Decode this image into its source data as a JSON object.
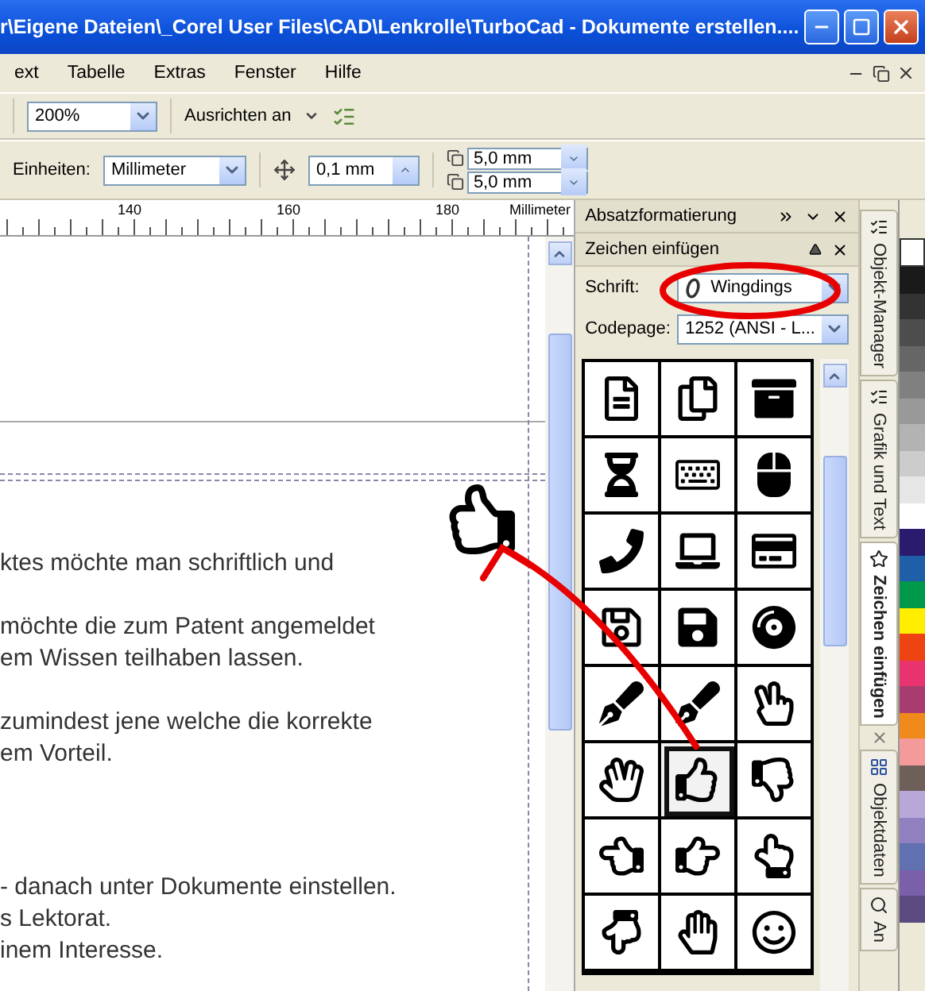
{
  "window": {
    "title": "r\\Eigene Dateien\\_Corel User Files\\CAD\\Lenkrolle\\TurboCad - Dokumente erstellen...."
  },
  "menu": [
    "ext",
    "Tabelle",
    "Extras",
    "Fenster",
    "Hilfe"
  ],
  "toolbar": {
    "zoom": "200%",
    "snap": "Ausrichten an"
  },
  "property_bar": {
    "units_label": "Einheiten:",
    "units": "Millimeter",
    "nudge": "0,1 mm",
    "duplicate_x": "5,0 mm",
    "duplicate_y": "5,0 mm"
  },
  "ruler": {
    "labels": [
      "140",
      "160",
      "180"
    ],
    "unit": "Millimeter"
  },
  "document": {
    "paragraphs": [
      [
        "ktes möchte man schriftlich und"
      ],
      [
        "möchte die zum Patent angemeldet",
        "em Wissen teilhaben lassen."
      ],
      [
        "zumindest jene welche die korrekte",
        "em Vorteil."
      ],
      [
        "- danach unter Dokumente einstellen.",
        "s Lektorat.",
        "inem Interesse."
      ]
    ]
  },
  "docker": {
    "headers": [
      "Absatzformatierung",
      "Zeichen einfügen"
    ],
    "font_label": "Schrift:",
    "font": "Wingdings",
    "codepage_label": "Codepage:",
    "codepage": "1252  (ANSI - L...",
    "cells": [
      {
        "selected": false
      },
      {
        "selected": false
      },
      {
        "selected": false
      },
      {
        "selected": false
      },
      {
        "selected": false
      },
      {
        "selected": false
      },
      {
        "selected": false
      },
      {
        "selected": false
      },
      {
        "selected": false
      },
      {
        "selected": false
      },
      {
        "selected": false
      },
      {
        "selected": false
      },
      {
        "selected": false
      },
      {
        "selected": false
      },
      {
        "selected": false
      },
      {
        "selected": false
      },
      {
        "selected": true
      },
      {
        "selected": false
      },
      {
        "selected": false
      },
      {
        "selected": false
      },
      {
        "selected": false
      },
      {
        "selected": false
      },
      {
        "selected": false
      },
      {
        "selected": false
      }
    ]
  },
  "side_tabs": [
    {
      "label": "Objekt-Manager",
      "selected": false
    },
    {
      "label": "Grafik und Text",
      "selected": false
    },
    {
      "label": "Zeichen einfügen",
      "selected": true
    },
    {
      "label": "Objektdaten",
      "selected": false
    },
    {
      "label": "An",
      "selected": false
    }
  ],
  "palette": [
    {
      "color": "#1a1a1a"
    },
    {
      "color": "#333333"
    },
    {
      "color": "#4d4d4d"
    },
    {
      "color": "#666666"
    },
    {
      "color": "#808080"
    },
    {
      "color": "#999999"
    },
    {
      "color": "#b3b3b3"
    },
    {
      "color": "#cccccc"
    },
    {
      "color": "#e6e6e6"
    },
    {
      "color": "#ffffff"
    },
    {
      "color": "#2b1b6e"
    },
    {
      "color": "#1f5fa8"
    },
    {
      "color": "#00994c"
    },
    {
      "color": "#ffee00"
    },
    {
      "color": "#ee4411"
    },
    {
      "color": "#e8336e"
    },
    {
      "color": "#a83c6e"
    },
    {
      "color": "#f08a1a"
    },
    {
      "color": "#f49a9a"
    },
    {
      "color": "#6e6058"
    },
    {
      "color": "#b8a8d8"
    },
    {
      "color": "#9080c0"
    },
    {
      "color": "#6070b0"
    },
    {
      "color": "#7a60a8"
    },
    {
      "color": "#5a4a80"
    }
  ]
}
